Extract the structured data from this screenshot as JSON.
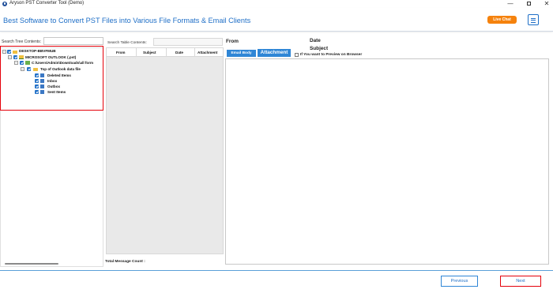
{
  "window": {
    "title": "Aryson PST Converter Tool (Demo)",
    "controls": {
      "minimize": "—",
      "close": "✕"
    }
  },
  "header": {
    "title": "Best Software to Convert PST Files into Various File Formats & Email Clients",
    "live_chat_label": "Live Chat"
  },
  "tree": {
    "search_label": "Search Tree Contents:",
    "search_value": "",
    "items": [
      {
        "label": "DESKTOP-BBVFMUB",
        "icon": "computer-icon"
      },
      {
        "label": "MICROSOFT OUTLOOK (.pst)",
        "icon": "pst-folder-icon"
      },
      {
        "label": "C:\\Users\\Admin\\Downloads\\all form",
        "icon": "drive-icon"
      },
      {
        "label": "Top of Outlook data file",
        "icon": "folder-icon"
      },
      {
        "label": "Deleted Items",
        "icon": "mail-folder-icon"
      },
      {
        "label": "Inbox",
        "icon": "mail-folder-icon"
      },
      {
        "label": "Outbox",
        "icon": "mail-folder-icon"
      },
      {
        "label": "Sent Items",
        "icon": "mail-folder-icon"
      }
    ]
  },
  "table": {
    "search_label": "Search Table Contents:",
    "search_value": "",
    "columns": [
      "From",
      "Subject",
      "Date",
      "Attachment"
    ],
    "rows": [],
    "total_label": "Total Message Count :"
  },
  "preview": {
    "from_label": "From",
    "date_label": "Date",
    "subject_label": "Subject",
    "email_body_label": "Email Body",
    "attachment_label": "Attachment",
    "browser_preview_label": "If You want to Preview on Browser",
    "browser_preview_checked": false
  },
  "footer": {
    "previous_label": "Previous",
    "next_label": "Next"
  },
  "colors": {
    "accent": "#1f6fc7",
    "button_blue": "#2f86d6",
    "live_chat": "#f5820d",
    "highlight_red": "#e5000a"
  }
}
